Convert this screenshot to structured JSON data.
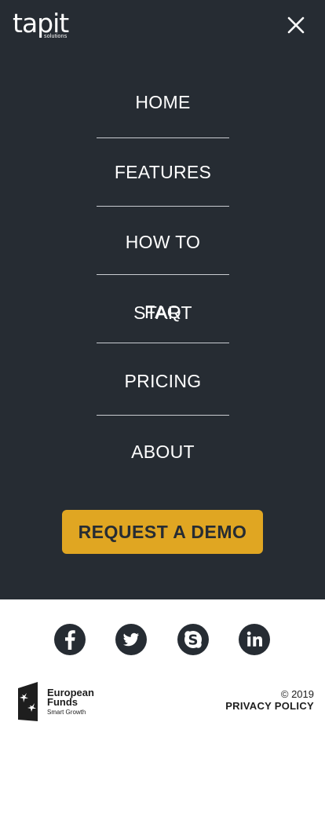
{
  "brand": {
    "name": "tapit",
    "sub": "solutions"
  },
  "header": {
    "close_icon": "close-icon"
  },
  "nav": {
    "items": [
      {
        "label": "HOME"
      },
      {
        "label": "FEATURES"
      },
      {
        "label": "HOW TO START"
      },
      {
        "label": "FAQ"
      },
      {
        "label": "PRICING"
      },
      {
        "label": "ABOUT"
      }
    ]
  },
  "cta": {
    "label": "REQUEST A DEMO",
    "color": "#e0a622"
  },
  "social": {
    "icons": [
      "facebook-icon",
      "twitter-icon",
      "skype-icon",
      "linkedin-icon"
    ]
  },
  "eu": {
    "line1": "European",
    "line2": "Funds",
    "line3": "Smart Growth"
  },
  "footer": {
    "copyright": "© 2019",
    "privacy": "PRIVACY POLICY"
  },
  "colors": {
    "panel": "#262c33",
    "accent": "#e0a622"
  }
}
